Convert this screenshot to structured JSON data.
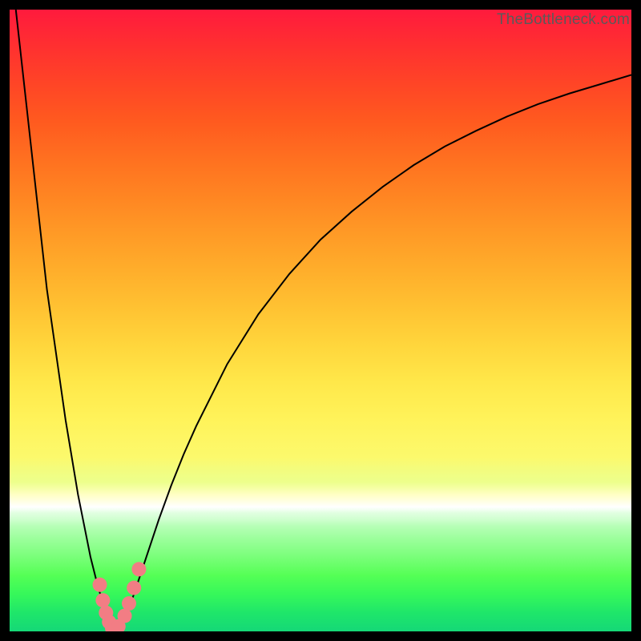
{
  "watermark": "TheBottleneck.com",
  "colors": {
    "marker": "#f27d84",
    "curve": "#000000",
    "frame": "#000000"
  },
  "chart_data": {
    "type": "line",
    "title": "",
    "xlabel": "",
    "ylabel": "",
    "xlim": [
      0,
      100
    ],
    "ylim": [
      0,
      100
    ],
    "series": [
      {
        "name": "bottleneck-curve",
        "x": [
          1,
          2,
          3,
          4,
          5,
          6,
          7,
          8,
          9,
          10,
          11,
          12,
          13,
          14,
          15,
          16,
          17,
          18,
          19,
          20,
          22,
          24,
          26,
          28,
          30,
          35,
          40,
          45,
          50,
          55,
          60,
          65,
          70,
          75,
          80,
          85,
          90,
          95,
          100
        ],
        "values": [
          100,
          91,
          82,
          73,
          64,
          55,
          48,
          41,
          34,
          28,
          22,
          17,
          12,
          8,
          4.5,
          1.8,
          0.2,
          1.2,
          3.2,
          6.0,
          12,
          18,
          23.5,
          28.5,
          33,
          43,
          51,
          57.5,
          63,
          67.5,
          71.5,
          75,
          78,
          80.5,
          82.8,
          84.8,
          86.5,
          88,
          89.5
        ]
      }
    ],
    "markers": {
      "name": "highlight-points",
      "x": [
        14.5,
        15.0,
        15.5,
        16.0,
        16.5,
        17.0,
        17.5,
        18.5,
        19.2,
        20.0,
        20.8
      ],
      "values": [
        7.5,
        5.0,
        3.0,
        1.5,
        0.5,
        0.2,
        0.8,
        2.5,
        4.5,
        7.0,
        10.0
      ]
    }
  }
}
